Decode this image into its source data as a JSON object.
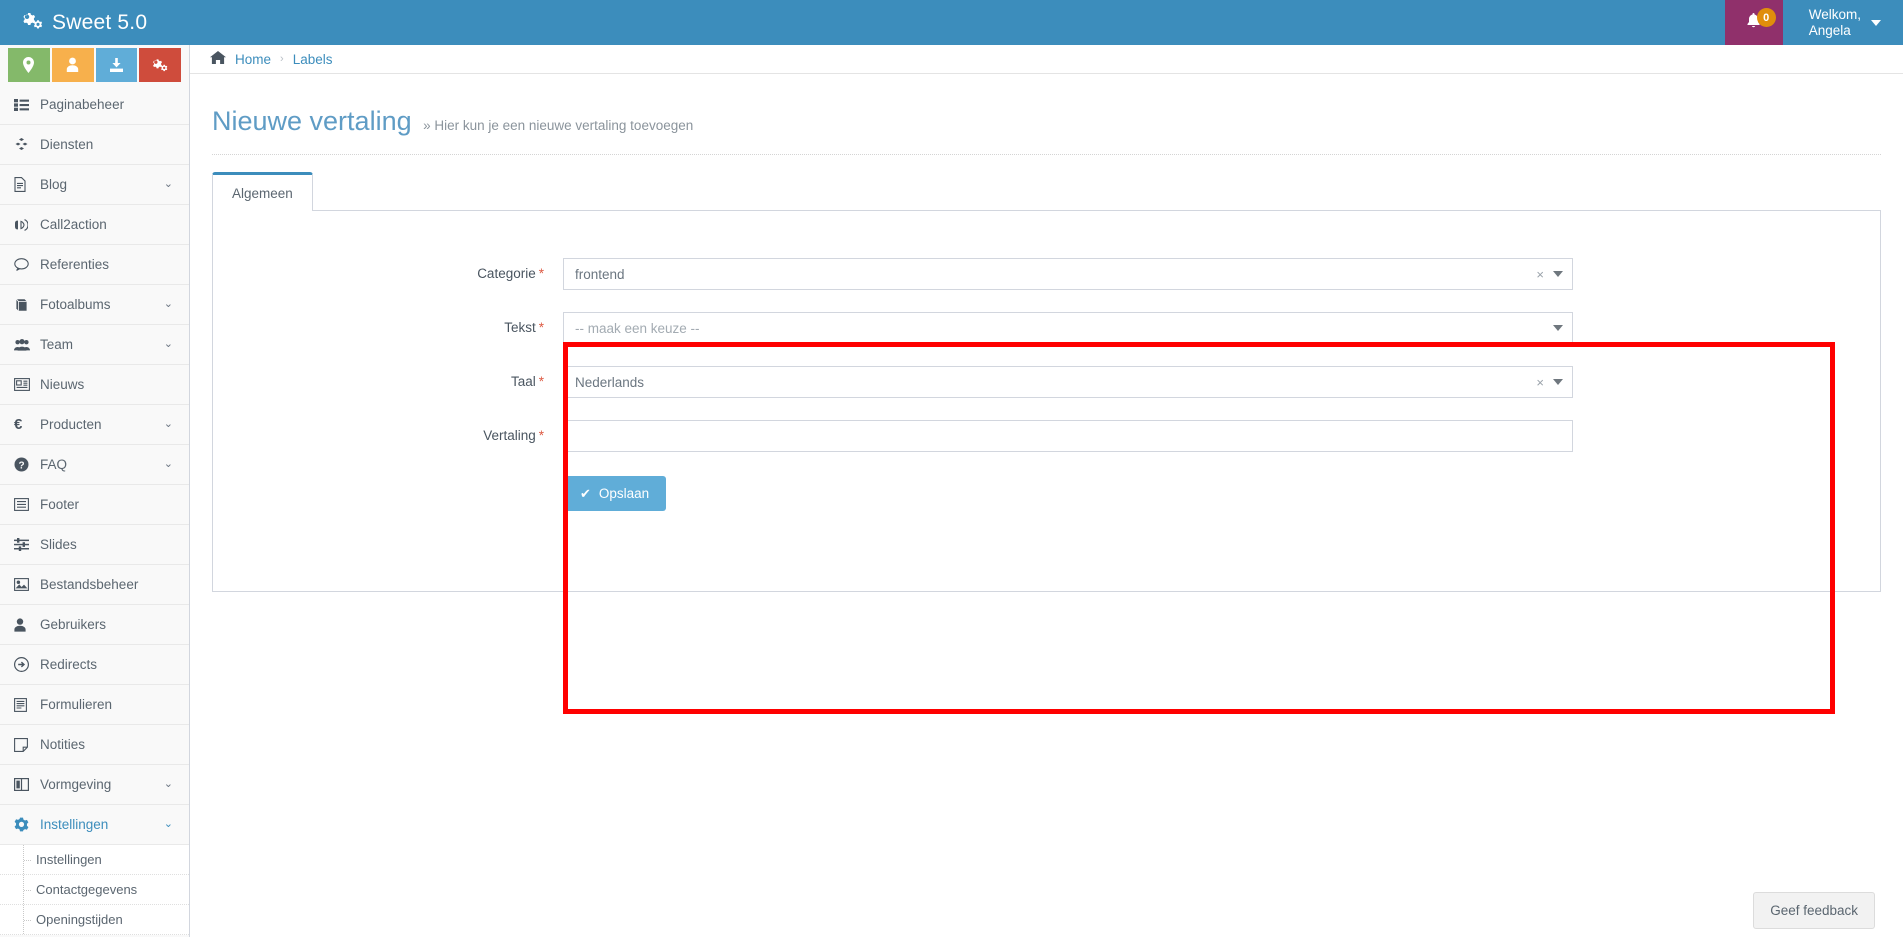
{
  "topbar": {
    "logo_text": "Sweet 5.0",
    "logo_icon": "cogs-icon",
    "bell_icon": "bell-icon",
    "notification_count": "0",
    "user_greeting": "Welkom,\nAngela"
  },
  "quick_actions": [
    {
      "name": "map-marker",
      "glyph": "▾",
      "color": "#84b96a"
    },
    {
      "name": "user",
      "glyph": "▾",
      "color": "#f7b04c"
    },
    {
      "name": "download",
      "glyph": "▾",
      "color": "#60add8"
    },
    {
      "name": "cogs",
      "glyph": "▾",
      "color": "#cf4c3c"
    }
  ],
  "sidebar": {
    "items": [
      {
        "label": "Paginabeheer",
        "icon": "list-icon",
        "arrow": ""
      },
      {
        "label": "Diensten",
        "icon": "cubes-icon",
        "arrow": ""
      },
      {
        "label": "Blog",
        "icon": "file-text-icon",
        "arrow": "⌄"
      },
      {
        "label": "Call2action",
        "icon": "bullhorn-icon",
        "arrow": ""
      },
      {
        "label": "Referenties",
        "icon": "comment-icon",
        "arrow": ""
      },
      {
        "label": "Fotoalbums",
        "icon": "book-icon",
        "arrow": "⌄"
      },
      {
        "label": "Team",
        "icon": "users-icon",
        "arrow": "⌄"
      },
      {
        "label": "Nieuws",
        "icon": "newspaper-icon",
        "arrow": ""
      },
      {
        "label": "Producten",
        "icon": "euro-icon",
        "arrow": "⌄"
      },
      {
        "label": "FAQ",
        "icon": "question-circle-icon",
        "arrow": "⌄"
      },
      {
        "label": "Footer",
        "icon": "list-alt-icon",
        "arrow": ""
      },
      {
        "label": "Slides",
        "icon": "sliders-icon",
        "arrow": ""
      },
      {
        "label": "Bestandsbeheer",
        "icon": "image-icon",
        "arrow": ""
      },
      {
        "label": "Gebruikers",
        "icon": "user-icon",
        "arrow": ""
      },
      {
        "label": "Redirects",
        "icon": "arrow-circle-right-icon",
        "arrow": ""
      },
      {
        "label": "Formulieren",
        "icon": "wpforms-icon",
        "arrow": ""
      },
      {
        "label": "Notities",
        "icon": "sticky-note-icon",
        "arrow": ""
      },
      {
        "label": "Vormgeving",
        "icon": "columns-icon",
        "arrow": "⌄"
      },
      {
        "label": "Instellingen",
        "icon": "gear-icon",
        "arrow": "⌄",
        "active": true
      }
    ],
    "subitems": [
      {
        "label": "Instellingen"
      },
      {
        "label": "Contactgegevens"
      },
      {
        "label": "Openingstijden"
      }
    ]
  },
  "breadcrumb": {
    "home_icon": "home-icon",
    "items": [
      "Home",
      "Labels"
    ],
    "separator": "›"
  },
  "page": {
    "title": "Nieuwe vertaling",
    "subtitle": "» Hier kun je een nieuwe vertaling toevoegen"
  },
  "tabs": [
    {
      "label": "Algemeen",
      "active": true
    }
  ],
  "form": {
    "fields": [
      {
        "label": "Categorie",
        "required": "*",
        "type": "select2",
        "value": "frontend",
        "is_placeholder": false,
        "clear_icon": "×",
        "has_clear": true
      },
      {
        "label": "Tekst",
        "required": "*",
        "type": "select2",
        "value": "-- maak een keuze --",
        "is_placeholder": true,
        "clear_icon": "",
        "has_clear": false
      },
      {
        "label": "Taal",
        "required": "*",
        "type": "select2",
        "value": "Nederlands",
        "is_placeholder": false,
        "clear_icon": "×",
        "has_clear": true
      },
      {
        "label": "Vertaling",
        "required": "*",
        "type": "text",
        "value": "",
        "placeholder": ""
      }
    ],
    "save_button": {
      "label": "Opslaan",
      "icon": "check-icon",
      "icon_glyph": "✔"
    }
  },
  "feedback": {
    "label": "Geef feedback"
  },
  "colors": {
    "brand_blue": "#3c8dbc",
    "notification_magenta": "#90306b",
    "badge_orange": "#e08e0b",
    "save_blue": "#60add8",
    "annotation_red": "#ff0000",
    "required_red": "#dd5a43"
  }
}
